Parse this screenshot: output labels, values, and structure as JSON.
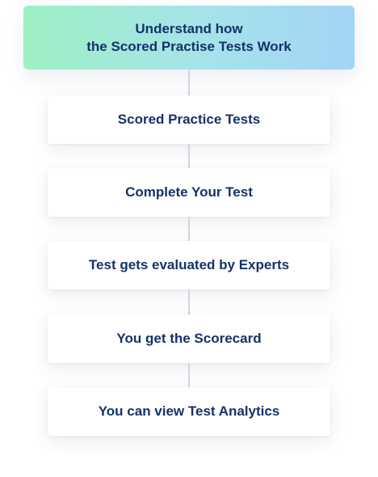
{
  "header": {
    "line1": "Understand how",
    "line2": "the Scored Practise Tests Work"
  },
  "steps": [
    {
      "label": "Scored Practice Tests"
    },
    {
      "label": "Complete Your Test"
    },
    {
      "label": "Test gets evaluated by Experts"
    },
    {
      "label": "You get the Scorecard"
    },
    {
      "label": "You can view Test Analytics"
    }
  ],
  "colors": {
    "text": "#14326b",
    "gradient_start": "#9ef0c3",
    "gradient_end": "#a3d4f5",
    "connector": "#d0d6de"
  }
}
